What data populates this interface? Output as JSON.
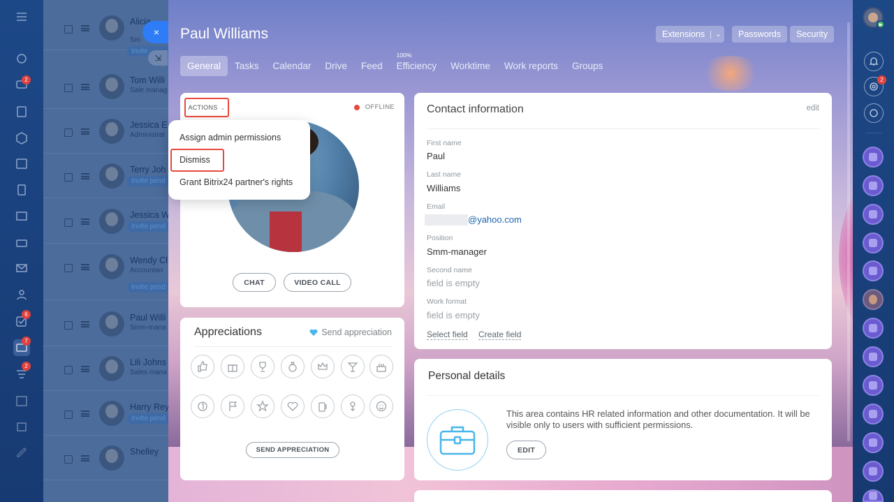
{
  "background_list": {
    "rows": [
      {
        "name": "Alicia",
        "sub": "Sm",
        "invite": "Invite"
      },
      {
        "name": "Tom Willi",
        "sub": "Sale manag",
        "invite": ""
      },
      {
        "name": "Jessica E",
        "sub": "Administrat",
        "invite": ""
      },
      {
        "name": "Terry Joh",
        "sub": "",
        "invite": "Invite pend"
      },
      {
        "name": "Jessica W",
        "sub": "",
        "invite": "Invite pend"
      },
      {
        "name": "Wendy Cl",
        "sub": "Accountan",
        "invite": "Invite pend"
      },
      {
        "name": "Paul Willi",
        "sub": "Smm-mana",
        "invite": ""
      },
      {
        "name": "Lili Johns",
        "sub": "Sales mana",
        "invite": ""
      },
      {
        "name": "Harry Rey",
        "sub": "",
        "invite": "Invite pend"
      },
      {
        "name": "Shelley",
        "sub": "",
        "invite": ""
      }
    ],
    "badges": {
      "chat": "2",
      "tasks": "6",
      "crm": "7",
      "other": "2"
    }
  },
  "slider": {
    "close_icon": "×",
    "collapse_icon": "⇲"
  },
  "header": {
    "title": "Paul Williams",
    "buttons": {
      "extensions": "Extensions",
      "passwords": "Passwords",
      "security": "Security"
    }
  },
  "tabs": [
    {
      "label": "General",
      "active": true
    },
    {
      "label": "Tasks"
    },
    {
      "label": "Calendar"
    },
    {
      "label": "Drive"
    },
    {
      "label": "Feed"
    },
    {
      "label": "Efficiency",
      "sup": "100%"
    },
    {
      "label": "Worktime"
    },
    {
      "label": "Work reports"
    },
    {
      "label": "Groups"
    }
  ],
  "profile_card": {
    "actions_label": "ACTIONS",
    "status": "OFFLINE",
    "status_color": "#e9493c",
    "chat_button": "CHAT",
    "video_button": "VIDEO CALL"
  },
  "actions_menu": {
    "items": [
      "Assign admin permissions",
      "Dismiss",
      "Grant Bitrix24 partner's rights"
    ]
  },
  "appreciations": {
    "title": "Appreciations",
    "send_link": "Send appreciation",
    "send_button": "SEND APPRECIATION",
    "icons": [
      "thumbs-up-icon",
      "gift-icon",
      "trophy-icon",
      "money-bag-icon",
      "crown-icon",
      "cocktail-icon",
      "cake-icon",
      "number-one-icon",
      "flag-icon",
      "star-icon",
      "heart-icon",
      "beer-icon",
      "flower-icon",
      "smile-icon"
    ]
  },
  "contact": {
    "title": "Contact information",
    "edit": "edit",
    "fields": [
      {
        "label": "First name",
        "value": "Paul"
      },
      {
        "label": "Last name",
        "value": "Williams"
      },
      {
        "label": "Email",
        "value": "@yahoo.com"
      },
      {
        "label": "Position",
        "value": "Smm-manager"
      },
      {
        "label": "Second name",
        "value": "field is empty"
      },
      {
        "label": "Work format",
        "value": "field is empty"
      }
    ],
    "select_field": "Select field",
    "create_field": "Create field"
  },
  "personal": {
    "title": "Personal details",
    "text": "This area contains HR related information and other documentation. It will be visible only to users with sufficient permissions.",
    "edit_button": "EDIT"
  },
  "right_bar": {
    "badge": "2"
  },
  "colors": {
    "accent_blue": "#2e7cf6",
    "highlight_red": "#e7493d",
    "sidebar": "#1d4887"
  }
}
